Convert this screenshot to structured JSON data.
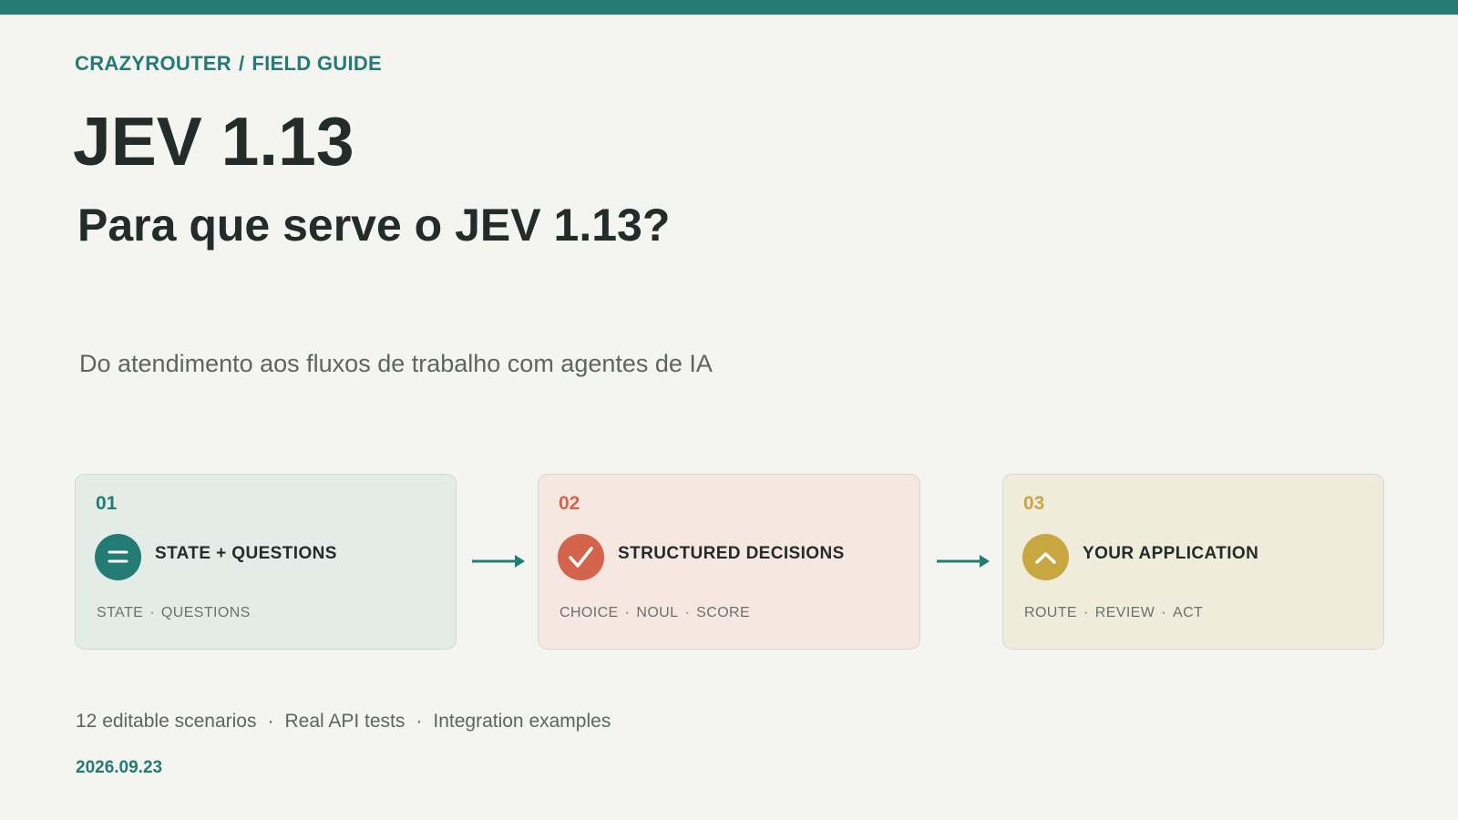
{
  "header": {
    "breadcrumb": [
      "CRAZYROUTER",
      "FIELD GUIDE"
    ],
    "breadcrumb_separator": "/",
    "title": "JEV 1.13",
    "subtitle": "Para que serve o JEV 1.13?",
    "tagline": "Do atendimento aos fluxos de trabalho com agentes de IA"
  },
  "steps": [
    {
      "number": "01",
      "heading": "STATE + QUESTIONS",
      "icon": "list-lines-icon",
      "color": "#247b73",
      "tags": [
        "STATE",
        "QUESTIONS"
      ]
    },
    {
      "number": "02",
      "heading": "STRUCTURED DECISIONS",
      "icon": "checkmark-icon",
      "color": "#d4634c",
      "tags": [
        "CHOICE",
        "NOUL",
        "SCORE"
      ]
    },
    {
      "number": "03",
      "heading": "YOUR APPLICATION",
      "icon": "chevron-up-icon",
      "color": "#c9a740",
      "tags": [
        "ROUTE",
        "REVIEW",
        "ACT"
      ]
    }
  ],
  "tag_separator": "·",
  "footer": {
    "features": [
      "12 editable scenarios",
      "Real API tests",
      "Integration examples"
    ],
    "date": "2026.09.23"
  },
  "colors": {
    "accent": "#247b73",
    "background": "#f4f4f0"
  }
}
